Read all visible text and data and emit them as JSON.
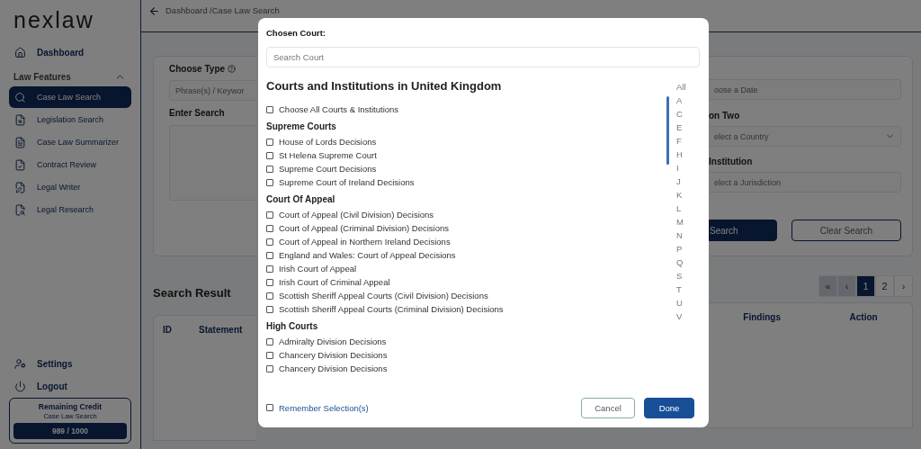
{
  "sidebar": {
    "logo": "nexlaw",
    "dashboard": "Dashboard",
    "section": {
      "label": "Law Features",
      "expanded": true
    },
    "items": [
      {
        "label": "Case Law Search",
        "kind": "search",
        "selected": true
      },
      {
        "label": "Legislation Search",
        "kind": "docsearch",
        "selected": false
      },
      {
        "label": "Case Law Summarizer",
        "kind": "doc",
        "selected": false
      },
      {
        "label": "Contract Review",
        "kind": "check",
        "selected": false
      },
      {
        "label": "Legal Writer",
        "kind": "pen",
        "selected": false
      },
      {
        "label": "Legal Research",
        "kind": "research",
        "selected": false
      }
    ],
    "settings": "Settings",
    "logout": "Logout",
    "credit": {
      "title": "Remaining Credit",
      "subtitle": "Case Law Search",
      "value": "989 / 1000"
    }
  },
  "breadcrumb": "Dashboard /Case Law Search",
  "form": {
    "choose_type": "Choose Type",
    "type_value": "Phrase(s) / Keywor",
    "enter_search": "Enter Search",
    "date_placeholder": "oose a Date",
    "option_two": "on Two",
    "country_placeholder": "elect a Country",
    "institution": "Institution",
    "jurisdiction_placeholder": "elect a Jurisdiction",
    "search_button": "Search",
    "clear_button": "Clear Search"
  },
  "results": {
    "title": "Search Result",
    "pagination": [
      {
        "label": "«",
        "selected": false,
        "disabled": true
      },
      {
        "label": "‹",
        "selected": false,
        "disabled": true
      },
      {
        "label": "1",
        "selected": true,
        "disabled": false
      },
      {
        "label": "2",
        "selected": false,
        "disabled": false
      },
      {
        "label": "›",
        "selected": false,
        "disabled": false
      }
    ],
    "columns_left": [
      "ID",
      "Statement"
    ],
    "columns_right": [
      "Findings",
      "Action"
    ]
  },
  "modal": {
    "title": "Chosen Court:",
    "search_placeholder": "Search Court",
    "heading": "Courts and Institutions in United Kingdom",
    "choose_all": {
      "label": "Choose All Courts & Institutions",
      "checked": false
    },
    "groups": [
      {
        "title": "Supreme Courts",
        "items": [
          {
            "label": "House of Lords Decisions",
            "checked": false
          },
          {
            "label": "St Helena Supreme Court",
            "checked": false
          },
          {
            "label": "Supreme Court Decisions",
            "checked": false
          },
          {
            "label": "Supreme Court of Ireland Decisions",
            "checked": false
          }
        ]
      },
      {
        "title": "Court Of Appeal",
        "items": [
          {
            "label": "Court of Appeal (Civil Division) Decisions",
            "checked": false
          },
          {
            "label": "Court of Appeal (Criminal Division) Decisions",
            "checked": false
          },
          {
            "label": "Court of Appeal in Northern Ireland Decisions",
            "checked": false
          },
          {
            "label": "England and Wales: Court of Appeal Decisions",
            "checked": false
          },
          {
            "label": "Irish Court of Appeal",
            "checked": false
          },
          {
            "label": "Irish Court of Criminal Appeal",
            "checked": false
          },
          {
            "label": "Scottish Sheriff Appeal Courts (Civil Division) Decisions",
            "checked": false
          },
          {
            "label": "Scottish Sheriff Appeal Courts (Criminal Division) Decisions",
            "checked": false
          }
        ]
      },
      {
        "title": "High Courts",
        "items": [
          {
            "label": "Admiralty Division Decisions",
            "checked": false
          },
          {
            "label": "Chancery Division Decisions",
            "checked": false
          },
          {
            "label": "Chancery Division Decisions",
            "checked": false
          }
        ]
      }
    ],
    "alphabet": [
      "All",
      "A",
      "C",
      "E",
      "F",
      "H",
      "I",
      "J",
      "K",
      "L",
      "M",
      "N",
      "P",
      "Q",
      "S",
      "T",
      "U",
      "V"
    ],
    "remember": {
      "label": "Remember Selection(s)",
      "checked": false
    },
    "cancel": "Cancel",
    "done": "Done"
  }
}
